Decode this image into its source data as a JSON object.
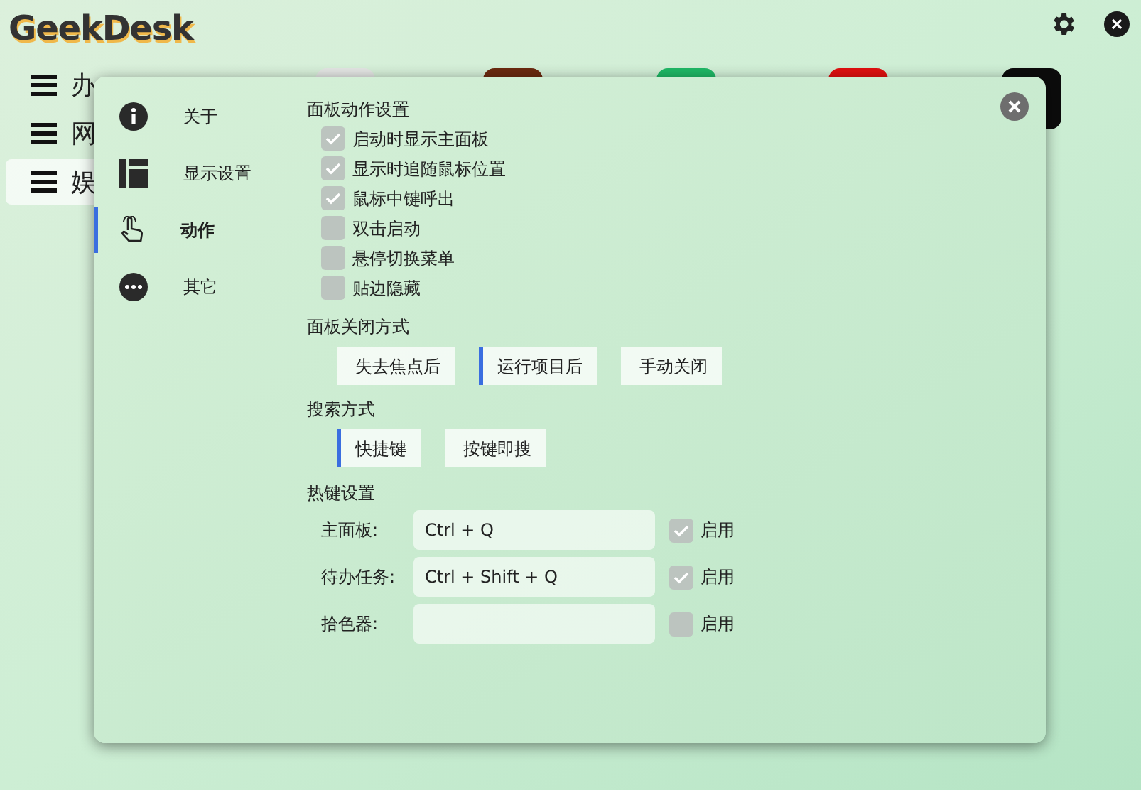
{
  "app": {
    "logo": "GeekDesk"
  },
  "menu": [
    {
      "label": "办",
      "selected": false
    },
    {
      "label": "网",
      "selected": false
    },
    {
      "label": "娱",
      "selected": true
    }
  ],
  "app_tiles": [
    {
      "color": "#e4e6e4"
    },
    {
      "color": "#6b2a10"
    },
    {
      "color": "#1fb866"
    },
    {
      "color": "#e01010"
    },
    {
      "color": "#0c0c0c"
    }
  ],
  "settings": {
    "nav": [
      {
        "label": "关于",
        "kind": "info",
        "selected": false
      },
      {
        "label": "显示设置",
        "kind": "layout",
        "selected": false
      },
      {
        "label": "动作",
        "kind": "hand",
        "selected": true
      },
      {
        "label": "其它",
        "kind": "more",
        "selected": false
      }
    ],
    "panel_actions": {
      "title": "面板动作设置",
      "options": [
        {
          "label": "启动时显示主面板",
          "checked": true
        },
        {
          "label": "显示时追随鼠标位置",
          "checked": true
        },
        {
          "label": "鼠标中键呼出",
          "checked": true
        },
        {
          "label": "双击启动",
          "checked": false
        },
        {
          "label": "悬停切换菜单",
          "checked": false
        },
        {
          "label": "贴边隐藏",
          "checked": false
        }
      ]
    },
    "close_mode": {
      "title": "面板关闭方式",
      "options": [
        {
          "label": "失去焦点后",
          "selected": false
        },
        {
          "label": "运行项目后",
          "selected": true
        },
        {
          "label": "手动关闭",
          "selected": false
        }
      ]
    },
    "search_mode": {
      "title": "搜索方式",
      "options": [
        {
          "label": "快捷键",
          "selected": true
        },
        {
          "label": "按键即搜",
          "selected": false
        }
      ]
    },
    "hotkeys": {
      "title": "热键设置",
      "rows": [
        {
          "label": "主面板:",
          "value": "Ctrl + Q",
          "enable_label": "启用",
          "enabled": true
        },
        {
          "label": "待办任务:",
          "value": "Ctrl + Shift + Q",
          "enable_label": "启用",
          "enabled": true
        },
        {
          "label": "拾色器:",
          "enable_label": "启用",
          "enabled": false
        }
      ]
    }
  }
}
